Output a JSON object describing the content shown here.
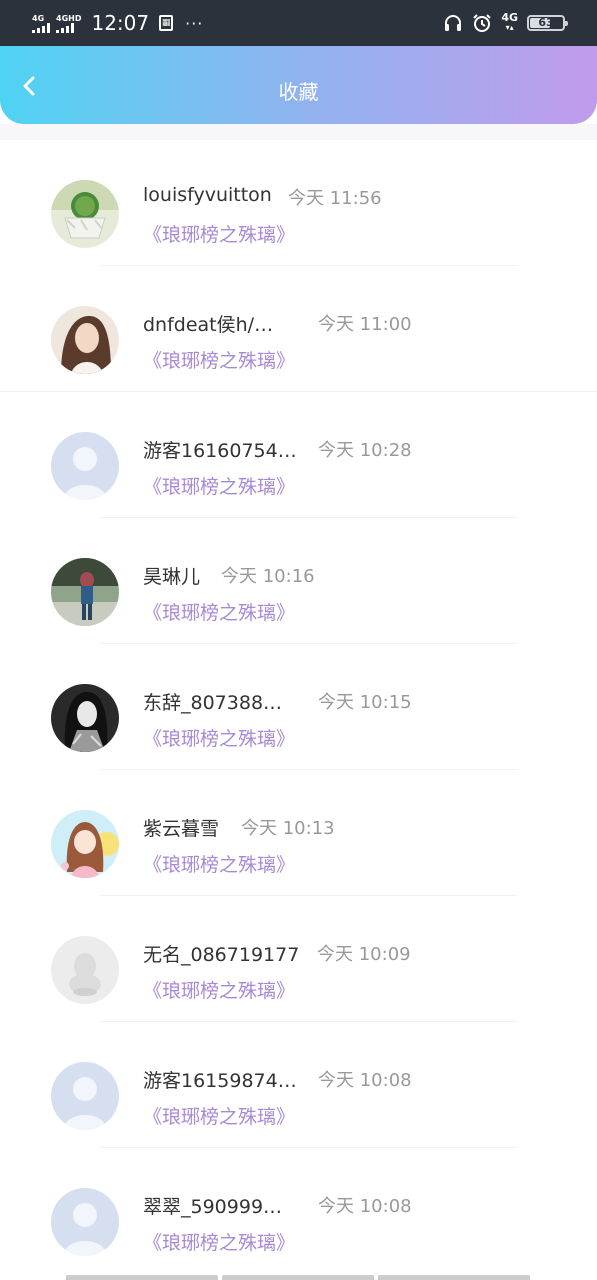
{
  "status_bar": {
    "signal1": "4G",
    "signal2": "4GHD",
    "time": "12:07",
    "sim_icon": "sim-card-icon",
    "dots": "···",
    "network": "4G",
    "battery": "63"
  },
  "header": {
    "title": "收藏",
    "back_icon": "chevron-left-icon"
  },
  "colors": {
    "header_gradient": [
      "#4fd3f2",
      "#c09bec"
    ],
    "work_title": "#a889d6",
    "name": "#333333",
    "time": "#999999"
  },
  "items": [
    {
      "name": "louisfyvuitton",
      "time": "今天 11:56",
      "work": "《琅琊榜之殊璃》",
      "avatar": "cactus"
    },
    {
      "name": "dnfdeat侯h/…",
      "time": "今天 11:00",
      "work": "《琅琊榜之殊璃》",
      "avatar": "girl-photo"
    },
    {
      "name": "游客16160754…",
      "time": "今天 10:28",
      "work": "《琅琊榜之殊璃》",
      "avatar": "default-user"
    },
    {
      "name": "昊琳儿",
      "time": "今天 10:16",
      "work": "《琅琊榜之殊璃》",
      "avatar": "outdoor-photo"
    },
    {
      "name": "东辞_807388…",
      "time": "今天 10:15",
      "work": "《琅琊榜之殊璃》",
      "avatar": "bw-anime"
    },
    {
      "name": "紫云暮雪",
      "time": "今天 10:13",
      "work": "《琅琊榜之殊璃》",
      "avatar": "anime-girl"
    },
    {
      "name": "无名_086719177",
      "time": "今天 10:09",
      "work": "《琅琊榜之殊璃》",
      "avatar": "qq-penguin"
    },
    {
      "name": "游客16159874…",
      "time": "今天 10:08",
      "work": "《琅琊榜之殊璃》",
      "avatar": "default-user"
    },
    {
      "name": "翠翠_590999…",
      "time": "今天 10:08",
      "work": "《琅琊榜之殊璃》",
      "avatar": "default-user"
    }
  ]
}
